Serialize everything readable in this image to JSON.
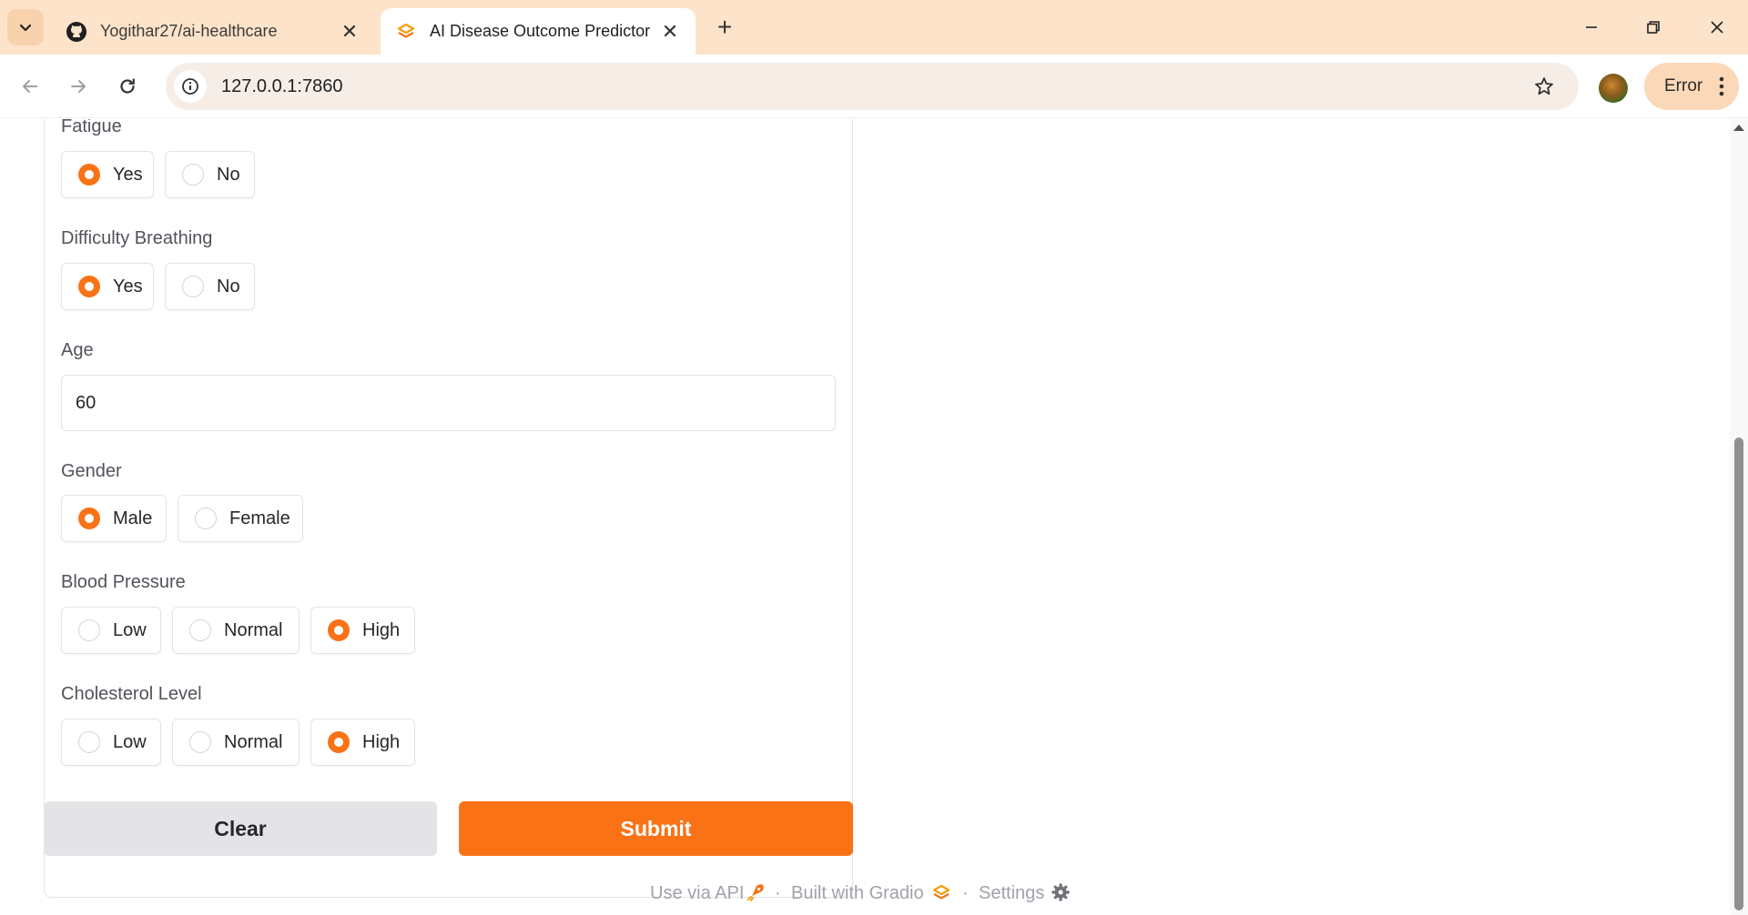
{
  "browser": {
    "tabs": [
      {
        "title": "Yogithar27/ai-healthcare",
        "icon": "github-icon",
        "active": false
      },
      {
        "title": "AI Disease Outcome Predictor",
        "icon": "gradio-icon",
        "active": true
      }
    ],
    "url": "127.0.0.1:7860",
    "profile_chip": "Error"
  },
  "form": {
    "fatigue": {
      "label": "Fatigue",
      "options": [
        "Yes",
        "No"
      ],
      "selected": "Yes"
    },
    "difficulty_breathing": {
      "label": "Difficulty Breathing",
      "options": [
        "Yes",
        "No"
      ],
      "selected": "Yes"
    },
    "age": {
      "label": "Age",
      "value": "60"
    },
    "gender": {
      "label": "Gender",
      "options": [
        "Male",
        "Female"
      ],
      "selected": "Male"
    },
    "blood_pressure": {
      "label": "Blood Pressure",
      "options": [
        "Low",
        "Normal",
        "High"
      ],
      "selected": "High"
    },
    "cholesterol": {
      "label": "Cholesterol Level",
      "options": [
        "Low",
        "Normal",
        "High"
      ],
      "selected": "High"
    }
  },
  "actions": {
    "clear_label": "Clear",
    "submit_label": "Submit"
  },
  "footer": {
    "api_label": "Use via API",
    "separator": "·",
    "built_label": "Built with Gradio",
    "settings_label": "Settings"
  },
  "colors": {
    "accent": "#f97316",
    "tabbar": "#fde3c9",
    "clear_button": "#e4e4e7"
  }
}
